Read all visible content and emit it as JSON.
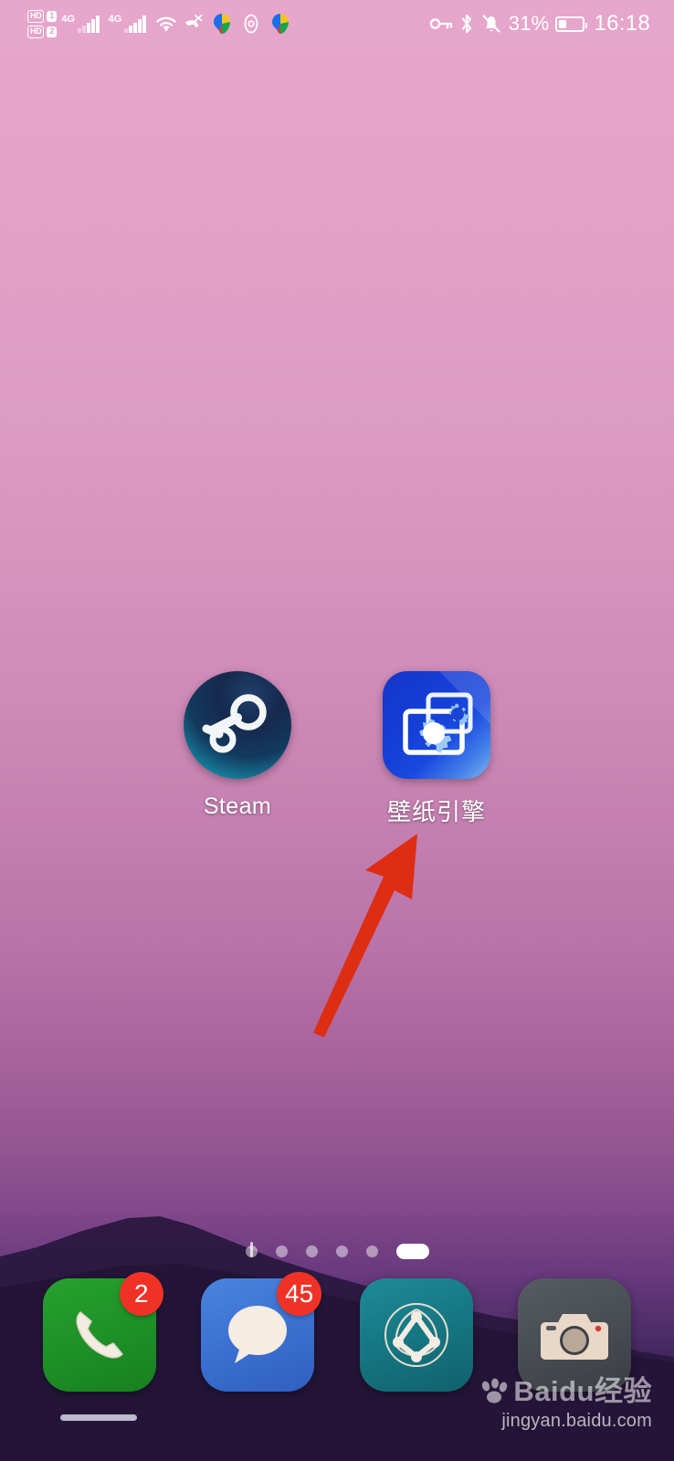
{
  "statusbar": {
    "sim1": {
      "hd_label": "HD",
      "sim_label": "1",
      "network": "4G"
    },
    "sim2": {
      "hd_label": "HD",
      "sim_label": "2",
      "network": "4G"
    },
    "icons": [
      "wifi-icon",
      "call-missed-icon",
      "app-color-icon",
      "location-icon",
      "app-color-icon-2",
      "key-icon",
      "bluetooth-icon",
      "bell-muted-icon"
    ],
    "battery_percent": "31%",
    "time": "16:18"
  },
  "apps": [
    {
      "label": "Steam",
      "icon": "steam-icon"
    },
    {
      "label": "壁纸引擎",
      "icon": "wallpaper-engine-icon"
    }
  ],
  "page_indicator": {
    "pages": 6,
    "active_index": 5
  },
  "dock": [
    {
      "name": "phone",
      "icon": "phone-icon",
      "badge": "2"
    },
    {
      "name": "messages",
      "icon": "message-bubble-icon",
      "badge": "45"
    },
    {
      "name": "browser",
      "icon": "browser-globe-icon",
      "badge": ""
    },
    {
      "name": "camera",
      "icon": "camera-icon",
      "badge": ""
    }
  ],
  "annotation": {
    "type": "arrow",
    "color": "#dd2d12",
    "points_to": "wallpaper-engine-icon"
  },
  "watermark": {
    "brand": "Baidu",
    "suffix": "经验",
    "url": "jingyan.baidu.com"
  },
  "colors": {
    "badge_red": "#f03226",
    "arrow_red": "#dd2d12",
    "wallpaper_top": "#e7a6cb",
    "wallpaper_bottom": "#251839"
  }
}
